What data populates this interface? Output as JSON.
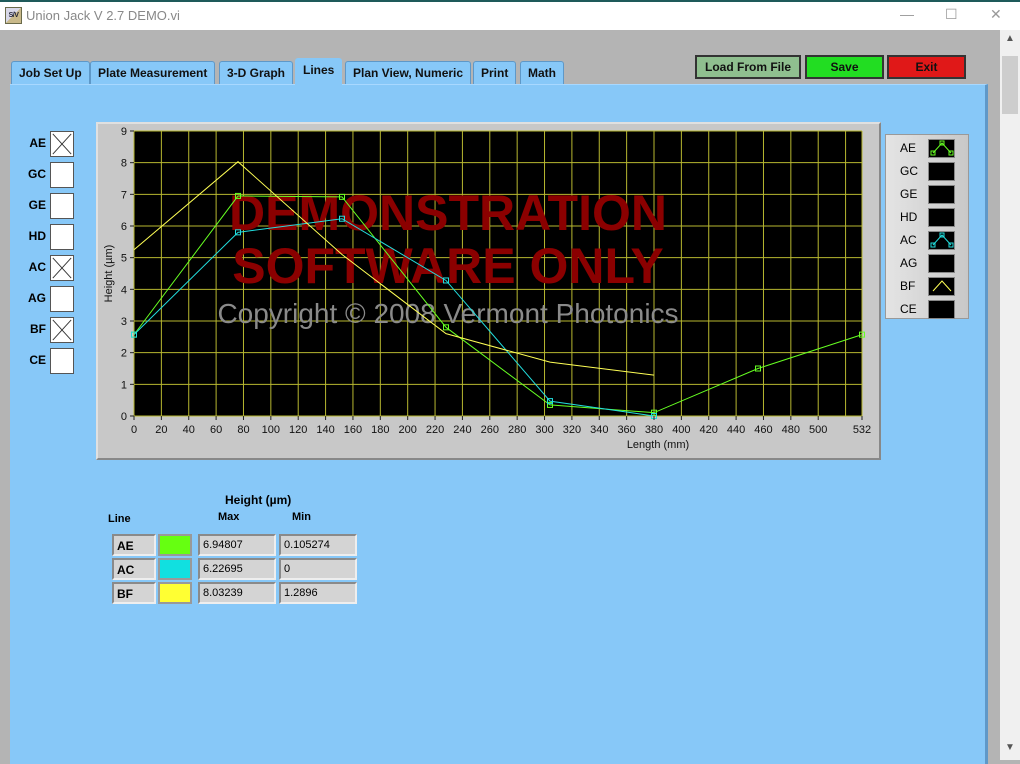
{
  "window": {
    "title": "Union Jack V 2.7 DEMO.vi",
    "icon_text": "S/V"
  },
  "tabs": [
    {
      "label": "Job Set Up"
    },
    {
      "label": "Plate Measurement"
    },
    {
      "label": "3-D Graph"
    },
    {
      "label": "Lines",
      "active": true
    },
    {
      "label": "Plan View, Numeric"
    },
    {
      "label": "Print"
    },
    {
      "label": "Math"
    }
  ],
  "toolbar": {
    "load_label": "Load From File",
    "save_label": "Save",
    "exit_label": "Exit",
    "colors": {
      "load": "#8fbf8f",
      "save": "#22dd22",
      "exit": "#e01818"
    }
  },
  "line_selectors": [
    {
      "label": "AE",
      "checked": true
    },
    {
      "label": "GC",
      "checked": false
    },
    {
      "label": "GE",
      "checked": false
    },
    {
      "label": "HD",
      "checked": false
    },
    {
      "label": "AC",
      "checked": true
    },
    {
      "label": "AG",
      "checked": false
    },
    {
      "label": "BF",
      "checked": true
    },
    {
      "label": "CE",
      "checked": false
    }
  ],
  "watermark": {
    "line1": "DEMONSTRATION",
    "line2": "SOFTWARE ONLY",
    "copyright": "Copyright © 2008 Vermont Photonics"
  },
  "chart_data": {
    "type": "line",
    "xlabel": "Length (mm)",
    "ylabel": "Height (µm)",
    "xlim": [
      0,
      532
    ],
    "ylim": [
      0,
      9
    ],
    "xticks": [
      0,
      20,
      40,
      60,
      80,
      100,
      120,
      140,
      160,
      180,
      200,
      220,
      240,
      260,
      280,
      300,
      320,
      340,
      360,
      380,
      400,
      420,
      440,
      460,
      480,
      500,
      532
    ],
    "yticks": [
      0,
      1,
      2,
      3,
      4,
      5,
      6,
      7,
      8,
      9
    ],
    "grid": true,
    "background": "#000000",
    "grid_color": "#b8b830",
    "series": [
      {
        "name": "AE",
        "color": "#66ff22",
        "markers": true,
        "x": [
          0,
          76,
          152,
          228,
          304,
          380,
          456,
          532
        ],
        "y": [
          2.57,
          6.95,
          6.92,
          2.8,
          0.35,
          0.105,
          1.5,
          2.57
        ]
      },
      {
        "name": "AC",
        "color": "#22dddd",
        "markers": true,
        "x": [
          0,
          76,
          152,
          228,
          304,
          380
        ],
        "y": [
          2.57,
          5.8,
          6.23,
          4.28,
          0.47,
          0
        ]
      },
      {
        "name": "BF",
        "color": "#ffff55",
        "markers": false,
        "x": [
          0,
          76,
          152,
          228,
          304,
          380
        ],
        "y": [
          5.25,
          8.03,
          5.1,
          2.6,
          1.7,
          1.29
        ]
      }
    ]
  },
  "legend": [
    {
      "label": "AE",
      "color": "#66ff22",
      "plot": "markers"
    },
    {
      "label": "GC",
      "plot": "none"
    },
    {
      "label": "GE",
      "plot": "none"
    },
    {
      "label": "HD",
      "plot": "none"
    },
    {
      "label": "AC",
      "color": "#22dddd",
      "plot": "markers"
    },
    {
      "label": "AG",
      "plot": "none"
    },
    {
      "label": "BF",
      "color": "#ffff55",
      "plot": "line"
    },
    {
      "label": "CE",
      "plot": "none"
    }
  ],
  "table": {
    "title": "Height (µm)",
    "line_header": "Line",
    "max_header": "Max",
    "min_header": "Min",
    "rows": [
      {
        "line": "AE",
        "color": "#66ff11",
        "max": "6.94807",
        "min": "0.105274"
      },
      {
        "line": "AC",
        "color": "#11e0e0",
        "max": "6.22695",
        "min": "0"
      },
      {
        "line": "BF",
        "color": "#ffff33",
        "max": "8.03239",
        "min": "1.2896"
      }
    ]
  }
}
